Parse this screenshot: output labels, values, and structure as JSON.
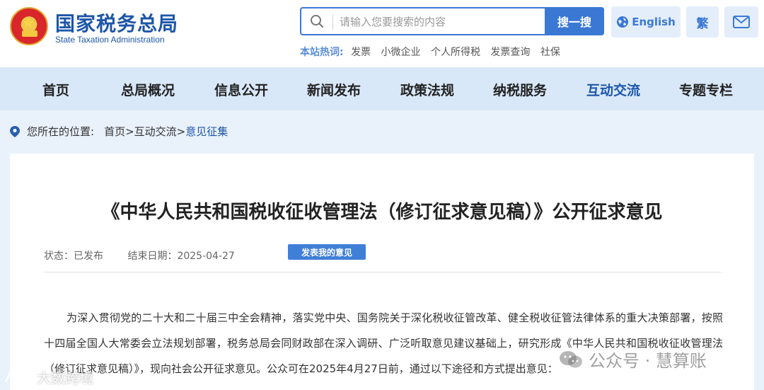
{
  "header": {
    "site_name": "国家税务总局",
    "site_name_en": "State Taxation Administration",
    "search": {
      "placeholder": "请输入您要搜索的内容",
      "button": "搜一搜"
    },
    "hot": {
      "label": "本站热词:",
      "items": [
        "发票",
        "小微企业",
        "个人所得税",
        "发票查询",
        "社保"
      ]
    },
    "english_label": "English",
    "traditional_label": "繁"
  },
  "nav": {
    "items": [
      "首页",
      "总局概况",
      "信息公开",
      "新闻发布",
      "政策法规",
      "纳税服务",
      "互动交流",
      "专题专栏"
    ],
    "active": "互动交流"
  },
  "breadcrumb": {
    "label": "您所在的位置:",
    "path": [
      "首页",
      "互动交流",
      "意见征集"
    ]
  },
  "article": {
    "title": "《中华人民共和国税收征收管理法（修订征求意见稿）》公开征求意见",
    "status": "状态：已发布",
    "end_date": "结束日期：2025-04-27",
    "opinion_button": "发表我的意见",
    "body": "为深入贯彻党的二十大和二十届三中全会精神，落实党中央、国务院关于深化税收征管改革、健全税收征管法律体系的重大决策部署，按照十四届全国人大常委会立法规划部署，税务总局会同财政部在深入调研、广泛听取意见建议基础上，研究形成《中华人民共和国税收征收管理法（修订征求意见稿）》，现向社会公开征求意见。公众可在2025年4月27日前，通过以下途径和方式提出意见："
  },
  "watermarks": {
    "right": "公众号 · 慧算账",
    "left": "大数跨境"
  },
  "colors": {
    "brand_blue": "#1d56a8",
    "accent_blue": "#3b78d4",
    "nav_bg": "#d9e8f9",
    "page_bg": "#e9f1fb"
  }
}
